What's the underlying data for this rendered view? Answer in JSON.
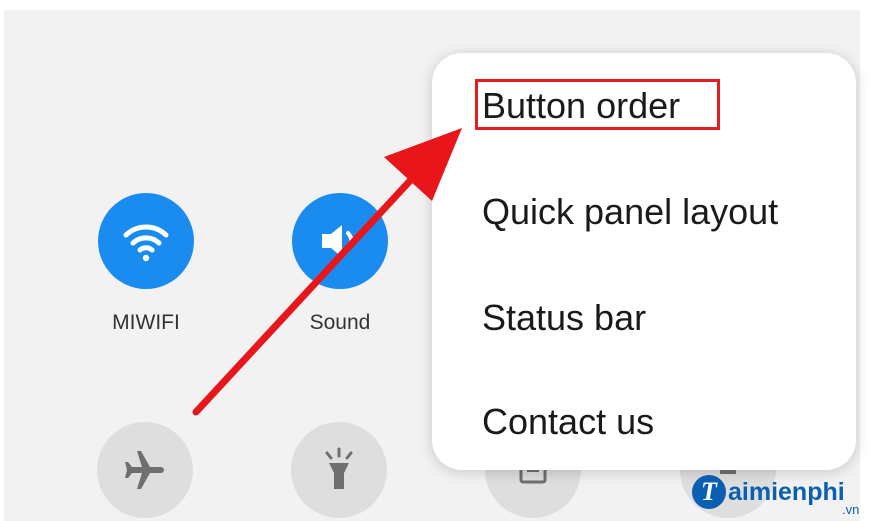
{
  "quick_tiles": {
    "wifi": {
      "label": "MIWIFI",
      "icon": "wifi-icon",
      "state": "on"
    },
    "sound": {
      "label": "Sound",
      "icon": "sound-icon",
      "state": "on"
    },
    "airplane": {
      "icon": "airplane-icon",
      "state": "off"
    },
    "flashlight": {
      "icon": "flashlight-icon",
      "state": "off"
    },
    "third": {
      "icon": "screen-rotate-icon",
      "state": "off"
    },
    "fourth": {
      "icon": "tile-icon",
      "state": "off"
    }
  },
  "menu": {
    "items": [
      {
        "label": "Button order",
        "highlighted": true
      },
      {
        "label": "Quick panel layout"
      },
      {
        "label": "Status bar"
      },
      {
        "label": "Contact us"
      }
    ]
  },
  "watermark": {
    "brand": "aimienphi",
    "logo_letter": "T",
    "tld": ".vn"
  },
  "colors": {
    "accent": "#1a8cf0",
    "highlight": "#e02020",
    "arrow": "#e8151b"
  }
}
